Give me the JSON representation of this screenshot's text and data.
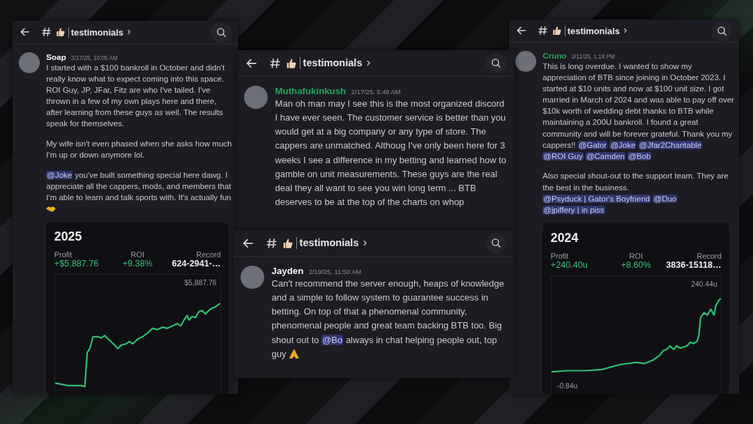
{
  "panels": [
    {
      "channel": "testimonials",
      "message": {
        "author": {
          "name": "Soap",
          "color": "#f2f3f5"
        },
        "time": "3/17/25, 10:05 AM",
        "paragraphs": [
          [
            {
              "kind": "text",
              "text": "I started with a $100 bankroll in October and didn't really know what to expect coming into this space. ROI Guy, JP, JFar, Fitz are who I've tailed. I've thrown in a few of my own plays here and there, after learning from these guys as well. The results speak for themselves."
            }
          ],
          [
            {
              "kind": "text",
              "text": "My wife isn't even phased when she asks how much I'm up or down anymore lol."
            }
          ],
          [
            {
              "kind": "mention",
              "text": "@Joke"
            },
            {
              "kind": "text",
              "text": " you've built something special here dawg. I appreciate all the cappers, mods, and members that I'm able to learn and talk sports with. It's actually fun "
            },
            {
              "kind": "handshake"
            }
          ]
        ]
      },
      "stats_card": {
        "year": "2025",
        "stats": [
          {
            "label": "Profit",
            "value": "+$5,887.76",
            "positive": true
          },
          {
            "label": "ROI",
            "value": "+9.38%",
            "positive": true
          },
          {
            "label": "Record",
            "value": "624-2941-…",
            "positive": false
          }
        ],
        "high_label": "$5,887.76"
      }
    },
    {
      "channel": "testimonials",
      "message": {
        "author": {
          "name": "Muthafukinkush",
          "color": "#23a55a"
        },
        "time": "2/17/25, 5:48 AM",
        "paragraphs": [
          [
            {
              "kind": "text",
              "text": "Man oh man may I see this is the most organized discord I have ever seen. The customer service is better than you would get at a big company or any type of store. The cappers are unmatched. Althoug I've only been here for 3 weeks I see a difference in my betting and learned how to gamble on unit measurements. These guys are the real deal they all want to see you win long term ... BTB deserves to be at the top of the charts on whop"
            }
          ]
        ]
      }
    },
    {
      "channel": "testimonials",
      "message": {
        "author": {
          "name": "Jayden",
          "color": "#f2f3f5"
        },
        "time": "2/19/25, 11:50 AM",
        "paragraphs": [
          [
            {
              "kind": "text",
              "text": "Can't recommend the server enough, heaps of knowledge and a simple to follow system to guarantee success in betting. On top of that a phenomenal community, phenomenal people and great team backing BTB too. Big shout out to "
            },
            {
              "kind": "mention",
              "text": "@Bo"
            },
            {
              "kind": "text",
              "text": " always in chat helping people out, top guy "
            },
            {
              "kind": "pray"
            }
          ]
        ]
      }
    },
    {
      "channel": "testimonials",
      "message": {
        "author": {
          "name": "Cruno",
          "color": "#23a55a"
        },
        "time": "2/11/25, 1:18 PM",
        "paragraphs": [
          [
            {
              "kind": "text",
              "text": "This is long overdue. I wanted to show my appreciation of BTB since joining in October 2023. I started at $10 units and now at $100 unit size. I got married in March of 2024 and was able to pay off over $10k worth of wedding debt thanks to BTB while maintaining a 200U bankroll. I found a great community and will be forever grateful. Thank you my cappers!! "
            },
            {
              "kind": "mention",
              "text": "@Gator"
            },
            {
              "kind": "mention",
              "text": "@Joke"
            },
            {
              "kind": "mention",
              "text": "@Jfar2Charitable"
            },
            {
              "kind": "mention",
              "text": "@ROI Guy"
            },
            {
              "kind": "mention",
              "text": "@Camden"
            },
            {
              "kind": "mention",
              "text": "@Bob"
            }
          ],
          [
            {
              "kind": "text",
              "text": "Also special shout-out to the support team. They are the best in the business. "
            },
            {
              "kind": "mention",
              "text": "@Psyduck | Gator's Boyfriend"
            },
            {
              "kind": "mention",
              "text": "@Duo"
            },
            {
              "kind": "mention",
              "text": "@jpiffery | in piss"
            }
          ]
        ]
      },
      "stats_card": {
        "year": "2024",
        "stats": [
          {
            "label": "Profit",
            "value": "+240.40u",
            "positive": true
          },
          {
            "label": "ROI",
            "value": "+8.60%",
            "positive": true
          },
          {
            "label": "Record",
            "value": "3836-15118…",
            "positive": false
          }
        ],
        "high_label": "240.44u",
        "low_label": "-0.84u"
      }
    }
  ]
}
